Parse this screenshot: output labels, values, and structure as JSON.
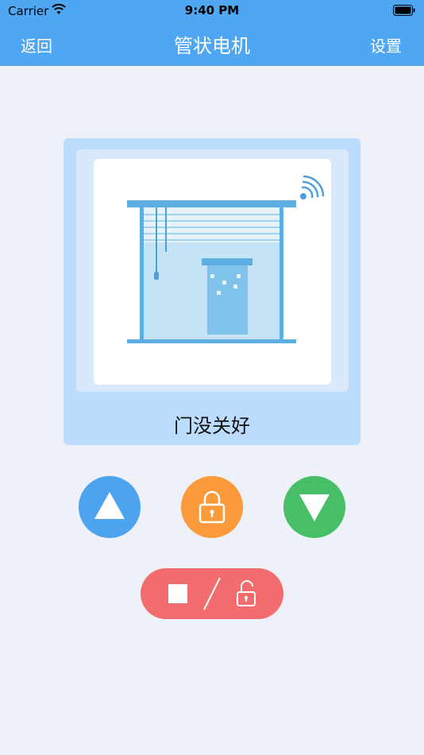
{
  "status_bar": {
    "carrier": "Carrier",
    "time": "9:40 PM"
  },
  "nav": {
    "back_label": "返回",
    "title": "管状电机",
    "settings_label": "设置"
  },
  "device": {
    "status_text": "门没关好",
    "image_icon": "garage-shutter-illustration",
    "signal_icon": "wifi-signal-icon"
  },
  "controls": {
    "up_icon": "triangle-up-icon",
    "lock_icon": "lock-icon",
    "down_icon": "triangle-down-icon",
    "stop_icon": "stop-square-icon",
    "unlock_icon": "unlock-icon"
  },
  "colors": {
    "header": "#4fa6f2",
    "up_button": "#4ea3ef",
    "lock_button": "#fb9a3a",
    "down_button": "#46bf68",
    "stop_button": "#f36d6e",
    "card_outer": "#bbdcfd",
    "card_inner": "#d8e9fd"
  }
}
